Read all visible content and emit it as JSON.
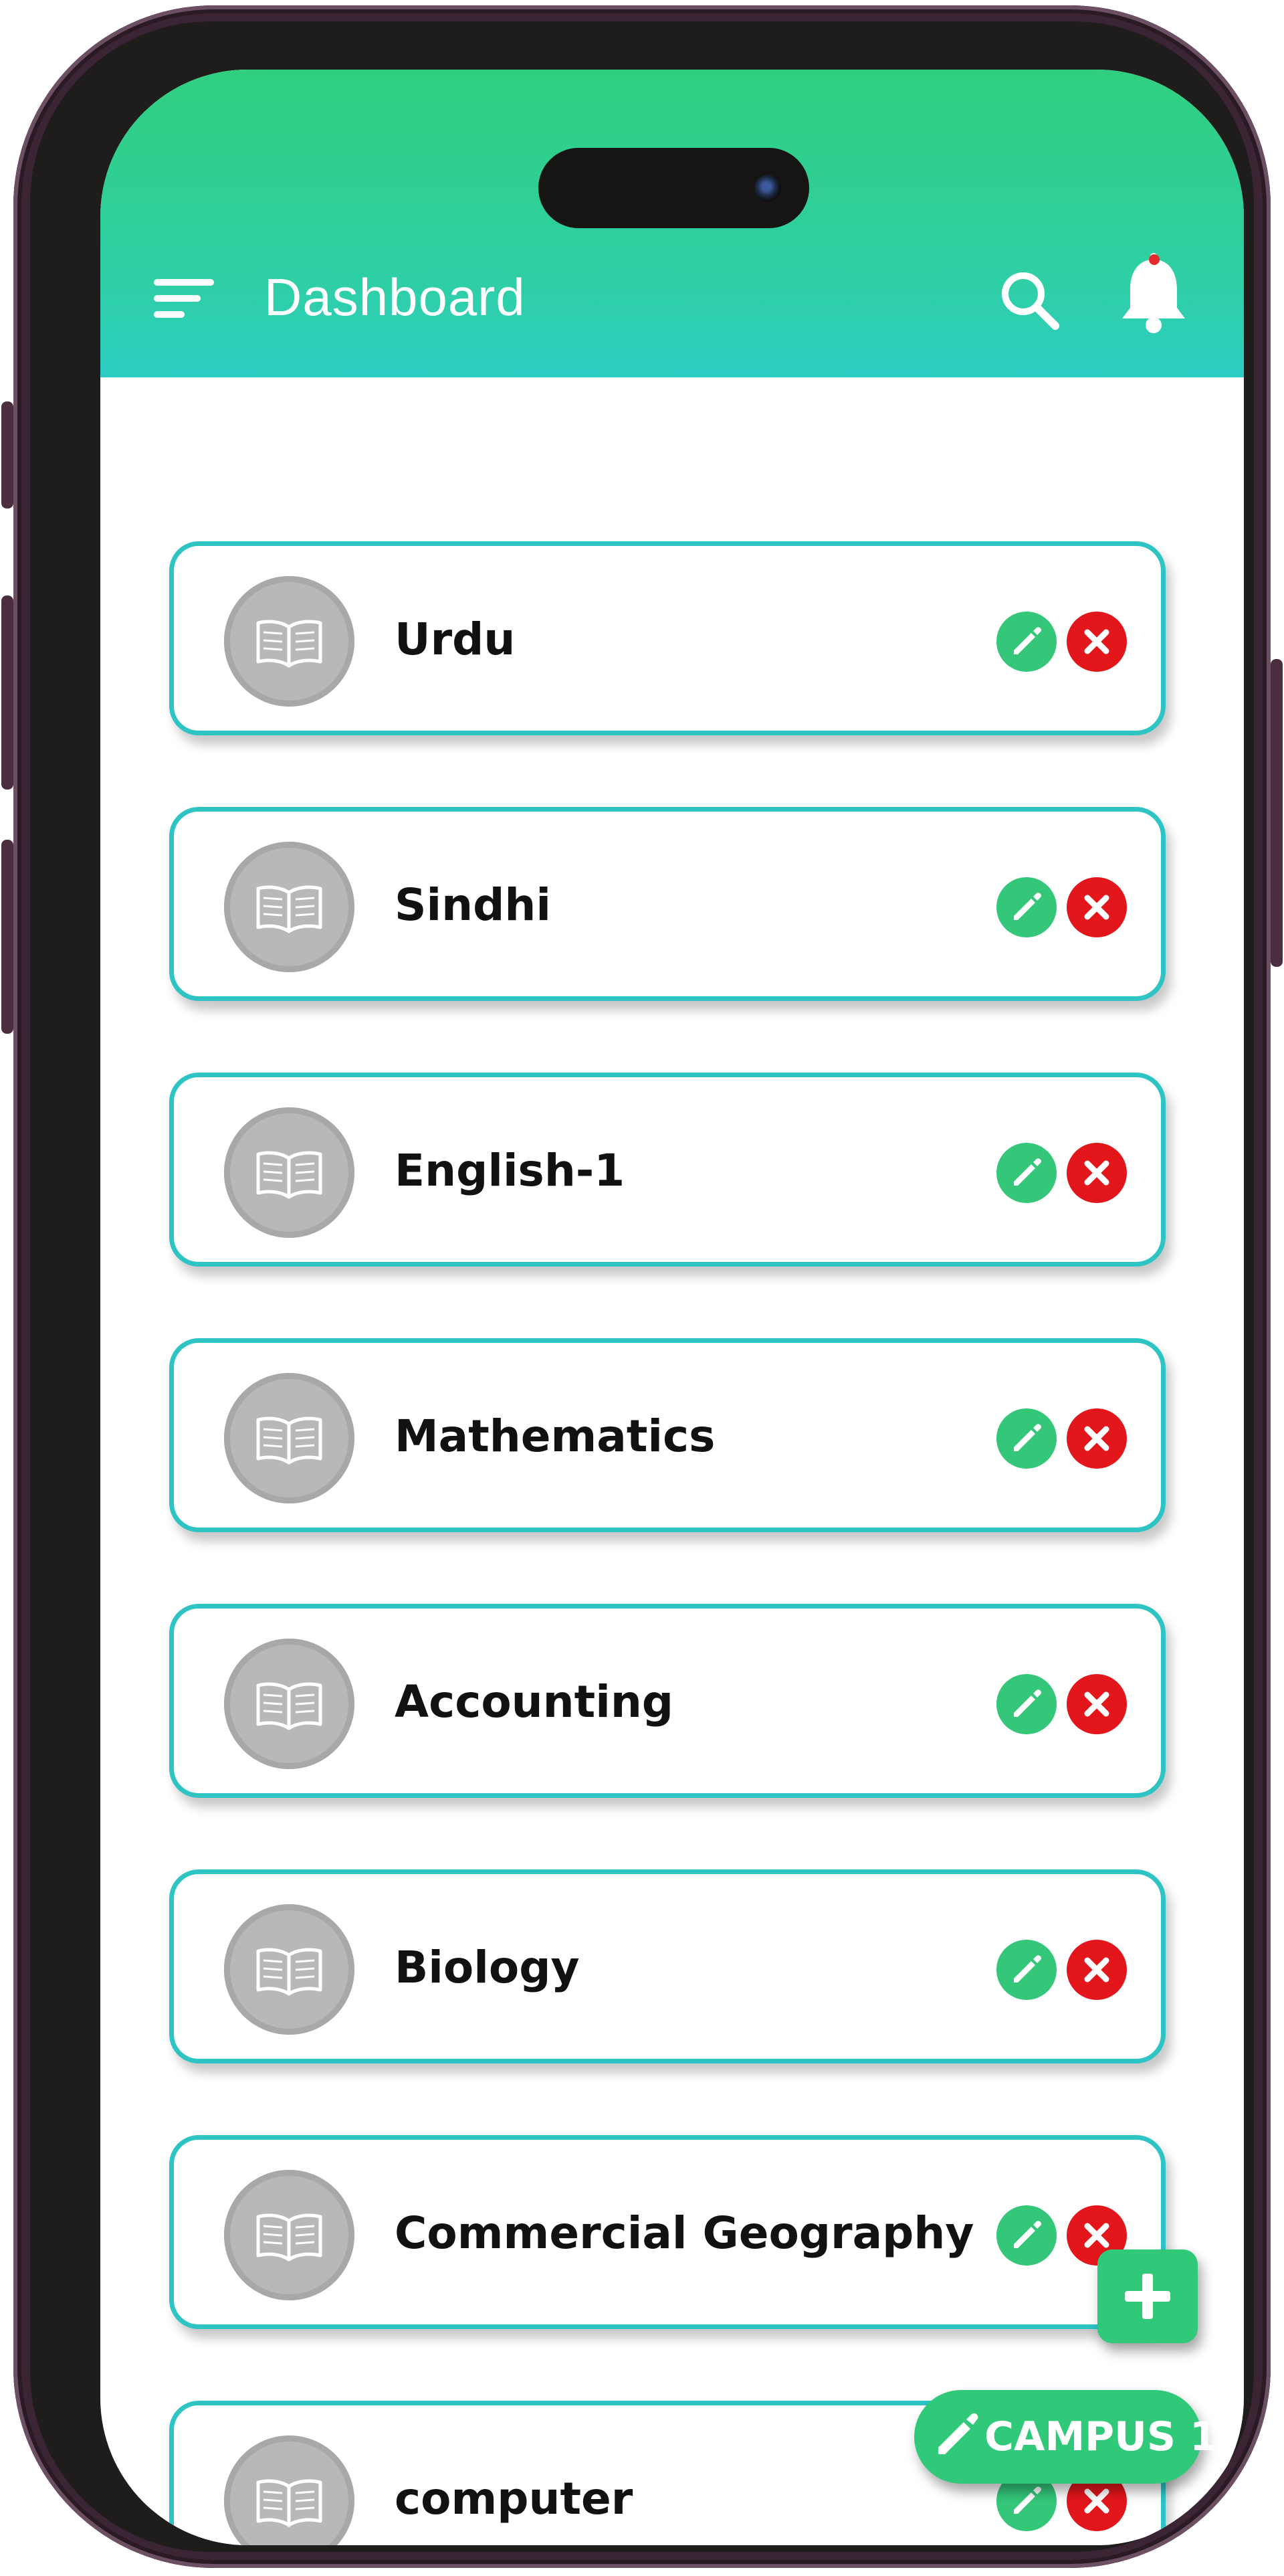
{
  "header": {
    "title": "Dashboard",
    "menu_icon": "menu-icon",
    "search_icon": "search-icon",
    "notification_icon": "bell-icon",
    "gradient_top": "#30cf7f",
    "gradient_bottom": "#2ecdc4"
  },
  "subjects": [
    {
      "name": "Urdu",
      "icon": "book-icon"
    },
    {
      "name": "Sindhi",
      "icon": "book-icon"
    },
    {
      "name": "English-1",
      "icon": "book-icon"
    },
    {
      "name": "Mathematics",
      "icon": "book-icon"
    },
    {
      "name": "Accounting",
      "icon": "book-icon"
    },
    {
      "name": "Biology",
      "icon": "book-icon"
    },
    {
      "name": "Commercial Geography",
      "icon": "book-icon"
    },
    {
      "name": "computer",
      "icon": "book-icon"
    }
  ],
  "actions": {
    "edit_icon": "pencil-icon",
    "delete_icon": "close-icon",
    "edit_color": "#34c77a",
    "delete_color": "#e3161b"
  },
  "fab": {
    "add_icon": "plus-icon",
    "campus_label": "CAMPUS 1",
    "campus_icon": "pencil-icon"
  },
  "colors": {
    "accent": "#30c97a",
    "card_border": "#2ec4c4"
  }
}
